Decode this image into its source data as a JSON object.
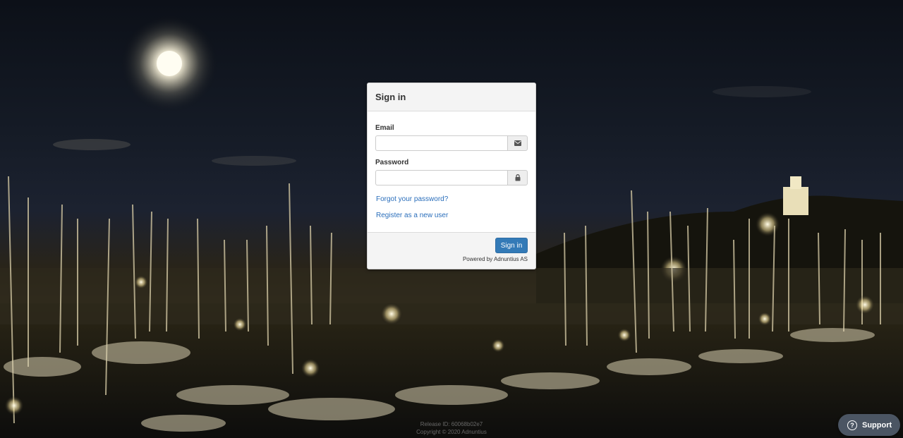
{
  "login": {
    "title": "Sign in",
    "email_label": "Email",
    "email_value": "",
    "password_label": "Password",
    "password_value": "",
    "forgot_link": "Forgot your password?",
    "register_link": "Register as a new user",
    "signin_button": "Sign in",
    "powered_by": "Powered by Adnuntius AS"
  },
  "footer": {
    "release": "Release ID: 60068b02e7",
    "copyright": "Copyright © 2020 Adnuntius"
  },
  "support": {
    "icon": "?",
    "label": "Support"
  },
  "icons": {
    "email": "envelope-icon",
    "password": "lock-icon",
    "support": "question-circle-icon"
  },
  "colors": {
    "primary": "#337ab7",
    "link": "#2a6ebb",
    "support_bg": "#4b5563"
  }
}
